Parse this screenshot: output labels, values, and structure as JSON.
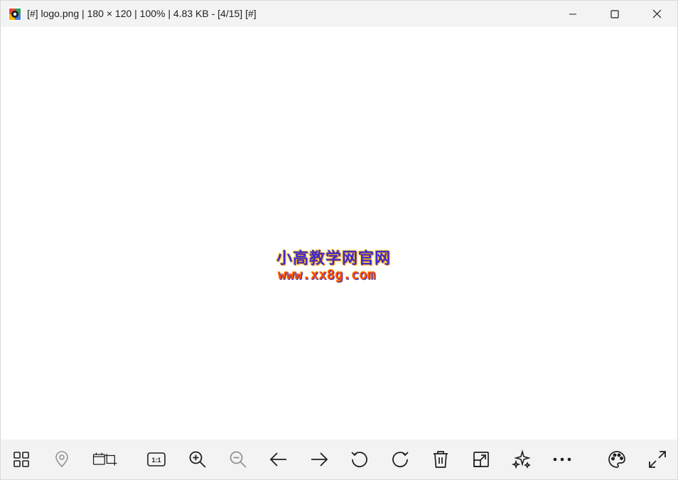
{
  "window": {
    "title": "[#] logo.png  |  180 × 120  |  100%  |  4.83 KB  -  [4/15] [#]",
    "controls": [
      "minimize-icon",
      "maximize-icon",
      "close-icon"
    ]
  },
  "image": {
    "line1": "小高教学网官网",
    "line2": "www.xx8g.com"
  },
  "toolbar": {
    "buttons": [
      {
        "icon": "gallery-icon"
      },
      {
        "icon": "location-pin-icon",
        "disabled": true
      },
      {
        "icon": "frame-crop-icon"
      },
      {
        "icon": "actual-size-icon",
        "label": "1:1"
      },
      {
        "icon": "zoom-in-icon"
      },
      {
        "icon": "zoom-out-icon",
        "disabled": true
      },
      {
        "icon": "arrow-left-icon"
      },
      {
        "icon": "arrow-right-icon"
      },
      {
        "icon": "rotate-left-icon"
      },
      {
        "icon": "rotate-right-icon"
      },
      {
        "icon": "trash-icon"
      },
      {
        "icon": "resize-icon"
      },
      {
        "icon": "sparkles-icon"
      },
      {
        "icon": "more-icon"
      },
      {
        "icon": "palette-icon"
      },
      {
        "icon": "fullscreen-icon"
      }
    ]
  },
  "colors": {
    "titlebar_bg": "#f3f3f3",
    "toolbar_bg": "#f3f3f3",
    "viewer_bg": "#ffffff",
    "icon": "#1f1f1f"
  }
}
